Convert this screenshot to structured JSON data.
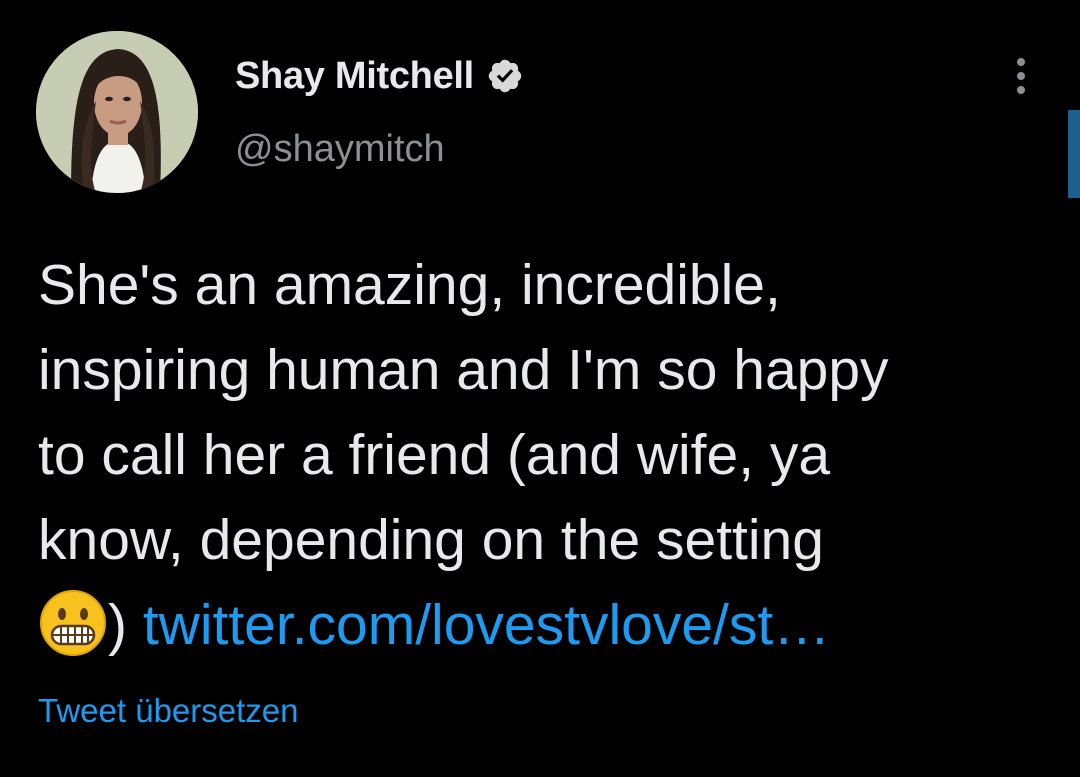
{
  "author": {
    "display_name": "Shay Mitchell",
    "handle": "@shaymitch",
    "verified": true,
    "avatar": "profile-photo"
  },
  "tweet": {
    "lines": [
      "She's an amazing, incredible,",
      "inspiring human and I'm so happy",
      "to call her a friend (and wife, ya",
      "know, depending on the setting"
    ],
    "last_line_prefix_emoji": "grimacing-face",
    "last_line_text": ")",
    "link_text": " twitter.com/lovestvlove/st…"
  },
  "actions": {
    "translate_label": "Tweet übersetzen"
  },
  "icons": {
    "more": "more-vertical-icon",
    "verified": "verified-badge-icon"
  },
  "colors": {
    "background": "#000000",
    "text": "#e7e9ea",
    "secondary_text": "#8b9095",
    "link": "#1d9bf0"
  }
}
